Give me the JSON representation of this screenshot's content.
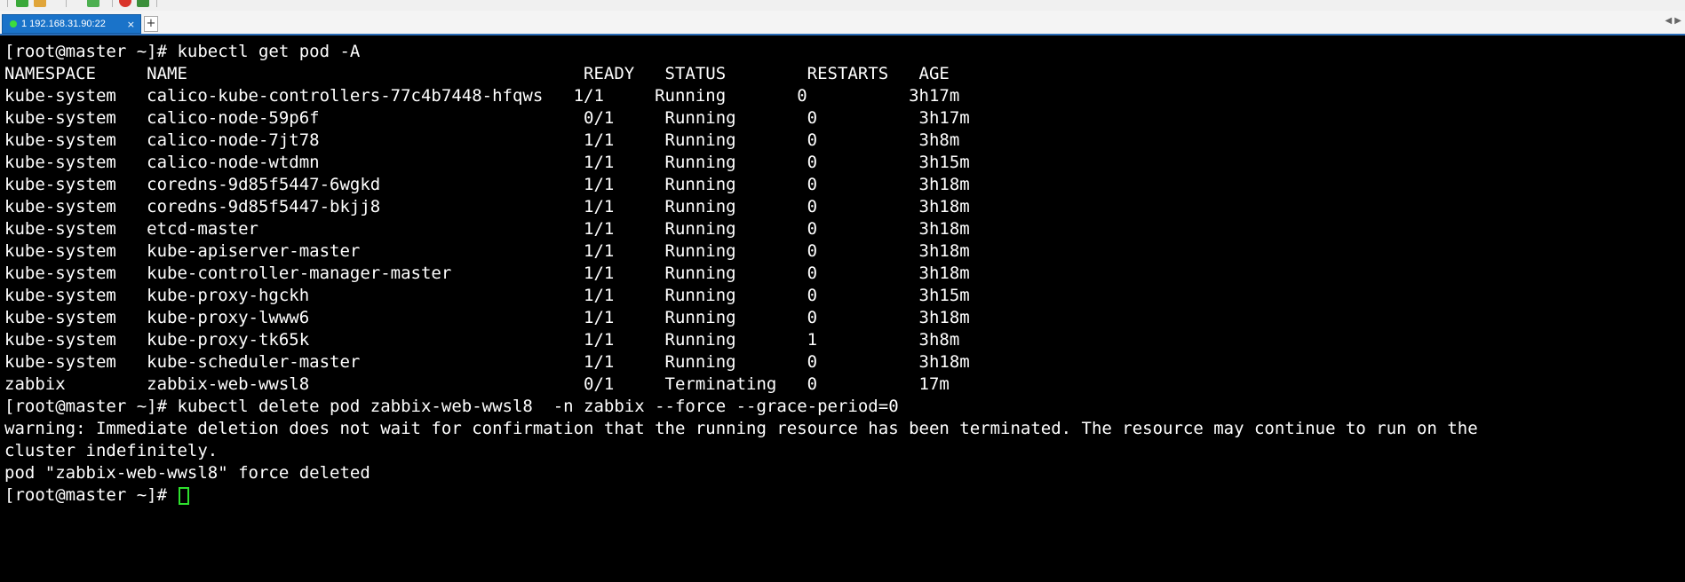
{
  "window": {
    "tab_label": "1 192.168.31.90:22",
    "tab_close": "×",
    "tab_add": "+",
    "tab_scroll": "◀ ▶"
  },
  "toolbar": {
    "icons": [
      "new-session-icon",
      "folder-icon",
      "settings-icon",
      "stop-icon",
      "log-icon"
    ]
  },
  "colors": {
    "accent": "#1a73c9",
    "cursor": "#2ee02e",
    "background": "#000000",
    "text": "#ffffff"
  },
  "terminal": {
    "lines": [
      "[root@master ~]# kubectl get pod -A",
      "NAMESPACE     NAME                                       READY   STATUS        RESTARTS   AGE",
      "kube-system   calico-kube-controllers-77c4b7448-hfqws   1/1     Running       0          3h17m",
      "kube-system   calico-node-59p6f                          0/1     Running       0          3h17m",
      "kube-system   calico-node-7jt78                          1/1     Running       0          3h8m",
      "kube-system   calico-node-wtdmn                          1/1     Running       0          3h15m",
      "kube-system   coredns-9d85f5447-6wgkd                    1/1     Running       0          3h18m",
      "kube-system   coredns-9d85f5447-bkjj8                    1/1     Running       0          3h18m",
      "kube-system   etcd-master                                1/1     Running       0          3h18m",
      "kube-system   kube-apiserver-master                      1/1     Running       0          3h18m",
      "kube-system   kube-controller-manager-master             1/1     Running       0          3h18m",
      "kube-system   kube-proxy-hgckh                           1/1     Running       0          3h15m",
      "kube-system   kube-proxy-lwww6                           1/1     Running       0          3h18m",
      "kube-system   kube-proxy-tk65k                           1/1     Running       1          3h8m",
      "kube-system   kube-scheduler-master                      1/1     Running       0          3h18m",
      "zabbix        zabbix-web-wwsl8                           0/1     Terminating   0          17m",
      "[root@master ~]# kubectl delete pod zabbix-web-wwsl8  -n zabbix --force --grace-period=0",
      "warning: Immediate deletion does not wait for confirmation that the running resource has been terminated. The resource may continue to run on the",
      "cluster indefinitely.",
      "pod \"zabbix-web-wwsl8\" force deleted"
    ],
    "current_prompt": "[root@master ~]# "
  }
}
